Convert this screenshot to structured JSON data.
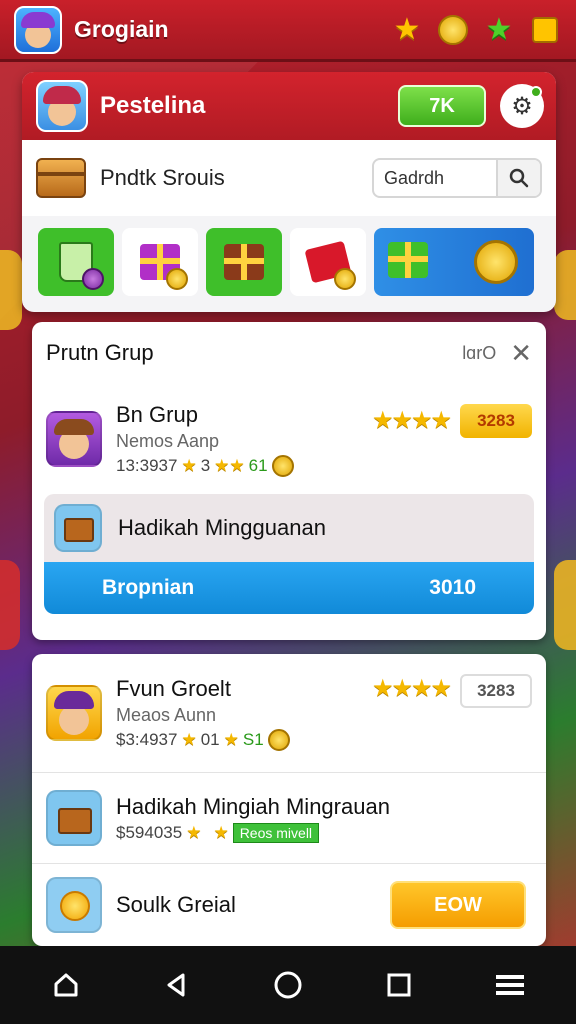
{
  "topbar": {
    "title": "Grogiain",
    "icons": [
      "star-icon",
      "smiley-coin-icon",
      "green-star-icon",
      "gift-badge-icon"
    ]
  },
  "panel": {
    "title": "Pestelina",
    "coin_label": "7K",
    "search_label": "Pndtk Srouis",
    "search_value": "Gadrdh",
    "shop_items": [
      "cup-coin",
      "purple-gift",
      "brown-gift",
      "red-envelope",
      "gift-pile-coins"
    ]
  },
  "group_card": {
    "title": "Prutn Grup",
    "tools_label": "lɑrO",
    "member": {
      "name": "Bn Grup",
      "sub": "Nemos Aanp",
      "meta": "13:3937",
      "meta_a": "3",
      "meta_b": "61",
      "badge": "3283",
      "rating": 4
    },
    "mission": {
      "name": "Hadikah Mingguanan"
    },
    "progress": {
      "left": "Bropnian",
      "right": "3010"
    }
  },
  "list_card": {
    "rows": [
      {
        "name": "Fvun Groelt",
        "sub": "Meaos Aunn",
        "meta": "$3:4937",
        "meta_a": "01",
        "meta_b": "S1",
        "badge": "3283",
        "rating": 4
      },
      {
        "name": "Hadikah Mingiah Mingrauan",
        "meta": "$594035",
        "tag": "Reos mivell"
      },
      {
        "name": "Soulk Greial",
        "button": "EOW"
      }
    ]
  },
  "navbar": {
    "icons": [
      "home-icon",
      "back-icon",
      "circle-home-icon",
      "recents-icon",
      "menu-icon"
    ]
  },
  "colors": {
    "brand_red": "#c9202a",
    "accent_green": "#3fae1c",
    "accent_blue": "#1a97e6",
    "accent_gold": "#f1b300"
  }
}
